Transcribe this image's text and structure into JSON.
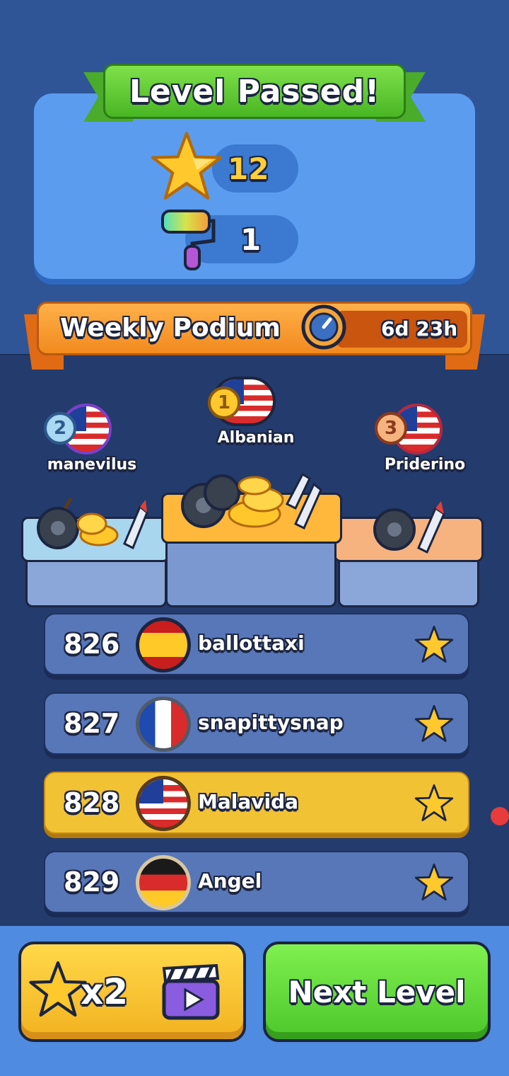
{
  "header": {
    "title": "Level Passed!"
  },
  "rewards": [
    {
      "icon": "star-icon",
      "value": "12"
    },
    {
      "icon": "paint-roller-icon",
      "value": "1"
    }
  ],
  "podium_header": {
    "title": "Weekly Podium",
    "timer": "6d 23h"
  },
  "podium": [
    {
      "rank": "1",
      "name": "Albanian",
      "flag": "malaysia-flag"
    },
    {
      "rank": "2",
      "name": "manevilus",
      "flag": "usa-flag"
    },
    {
      "rank": "3",
      "name": "Priderino",
      "flag": "usa-flag"
    }
  ],
  "leaderboard": [
    {
      "rank": "826",
      "name": "ballottaxi",
      "flag": "spain-flag"
    },
    {
      "rank": "827",
      "name": "snapittysnap",
      "flag": "france-flag"
    },
    {
      "rank": "828",
      "name": "Malavida",
      "flag": "usa-flag",
      "highlighted": true
    },
    {
      "rank": "829",
      "name": "Angel",
      "flag": "germany-flag"
    }
  ],
  "buttons": {
    "double_label": "x2",
    "next_label": "Next Level"
  },
  "colors": {
    "primary": "#2f5597",
    "accent_green": "#4cc72b",
    "accent_orange": "#f28a1e",
    "highlight": "#f2c235"
  }
}
